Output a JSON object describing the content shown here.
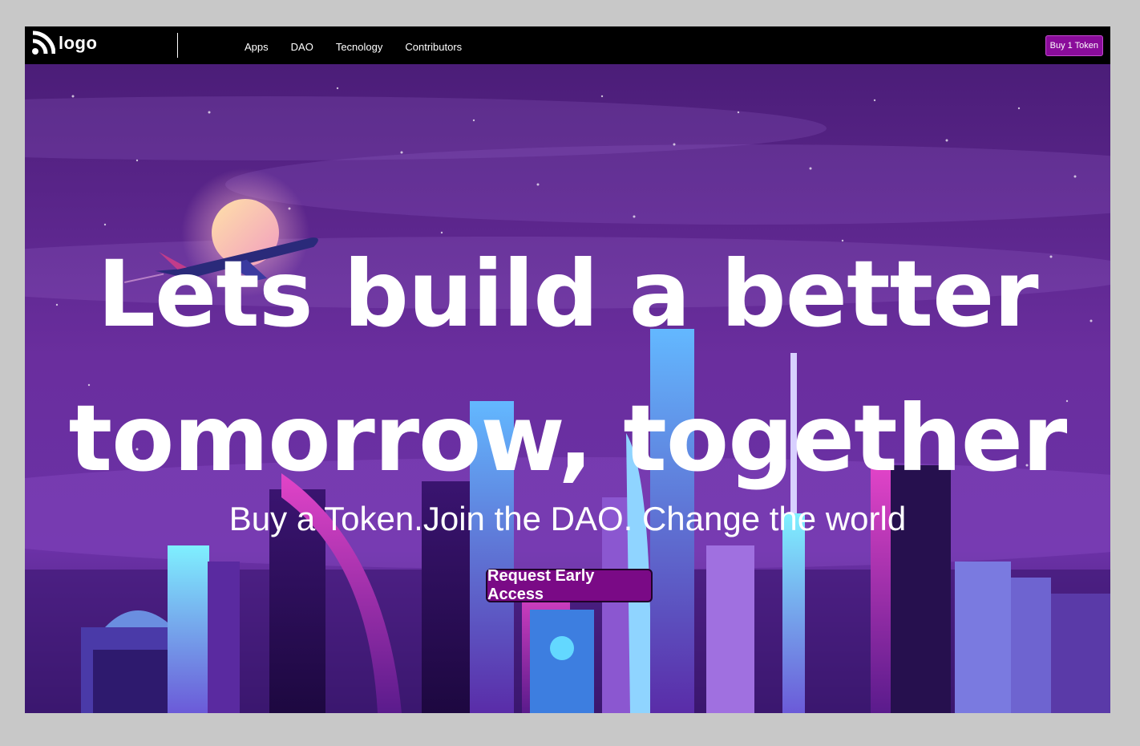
{
  "navbar": {
    "logo_text": "logo",
    "links": [
      "Apps",
      "DAO",
      "Tecnology",
      "Contributors"
    ],
    "buy_button": "Buy 1 Token"
  },
  "hero": {
    "headline_line1": "Lets build a better",
    "headline_line2": "tomorrow, together",
    "tagline": "Buy a Token.Join the DAO. Change the world",
    "cta_label": "Request Early Access"
  },
  "colors": {
    "navbar_bg": "#000000",
    "accent": "#8a0c9a",
    "sky_top": "#4a1b74",
    "sky_bottom": "#7a3fb0"
  }
}
